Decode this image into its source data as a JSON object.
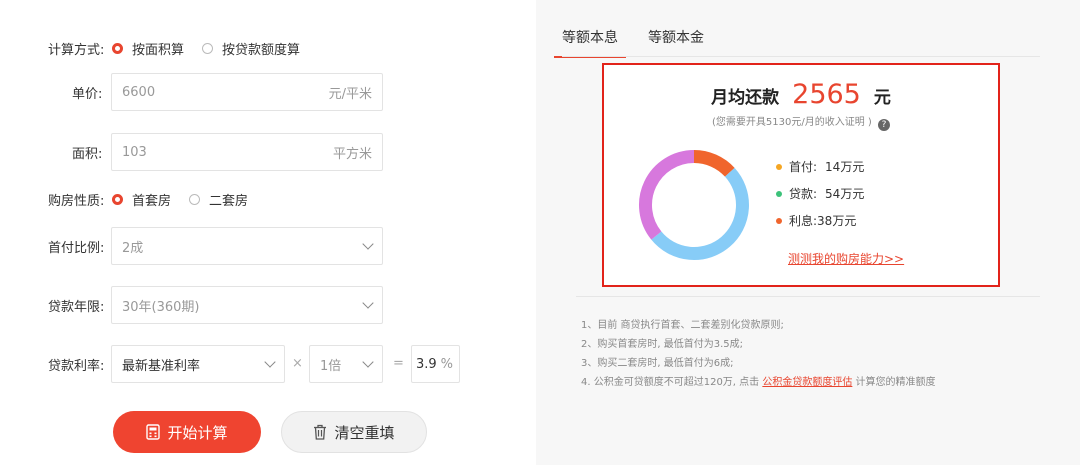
{
  "form": {
    "calc_method": {
      "label": "计算方式:",
      "options": [
        "按面积算",
        "按贷款额度算"
      ],
      "selected": 0
    },
    "unit_price": {
      "label": "单价:",
      "value": "6600",
      "unit": "元/平米"
    },
    "area": {
      "label": "面积:",
      "value": "103",
      "unit": "平方米"
    },
    "house_type": {
      "label": "购房性质:",
      "options": [
        "首套房",
        "二套房"
      ],
      "selected": 0
    },
    "down_payment": {
      "label": "首付比例:",
      "value": "2成"
    },
    "loan_term": {
      "label": "贷款年限:",
      "value": "30年(360期)"
    },
    "rate": {
      "label": "贷款利率:",
      "base": "最新基准利率",
      "times_symbol": "×",
      "multiplier": "1倍",
      "equals_symbol": "=",
      "value": "3.9",
      "unit": "%"
    },
    "calc_button": "开始计算",
    "clear_button": "清空重填"
  },
  "result": {
    "tabs": [
      "等额本息",
      "等额本金"
    ],
    "active_tab": 0,
    "monthly_label": "月均还款",
    "monthly_value": "2565",
    "monthly_unit": "元",
    "income_note": "(您需要开具5130元/月的收入证明 )",
    "help_icon": "?",
    "legend": [
      {
        "label": "首付:",
        "value": "14万元",
        "color": "#f5a623"
      },
      {
        "label": "贷款:",
        "value": "54万元",
        "color": "#3cc27a"
      },
      {
        "label": "利息:",
        "value": "38万元",
        "color": "#f0652d"
      }
    ],
    "test_link": "测测我的购房能力>>",
    "notes": [
      "1、目前 商贷执行首套、二套差别化贷款原则;",
      "2、购买首套房时, 最低首付为3.5成;",
      "3、购买二套房时, 最低首付为6成;"
    ],
    "note4_pre": "4. 公积金可贷额度不可超过120万, 点击",
    "note4_link": "公积金贷款额度评估",
    "note4_post": "计算您的精准额度"
  },
  "chart_data": {
    "type": "pie",
    "categories": [
      "首付",
      "贷款",
      "利息"
    ],
    "values": [
      14,
      54,
      38
    ],
    "unit": "万元",
    "colors": [
      "#f0652d",
      "#87ccf7",
      "#d778dd"
    ]
  }
}
